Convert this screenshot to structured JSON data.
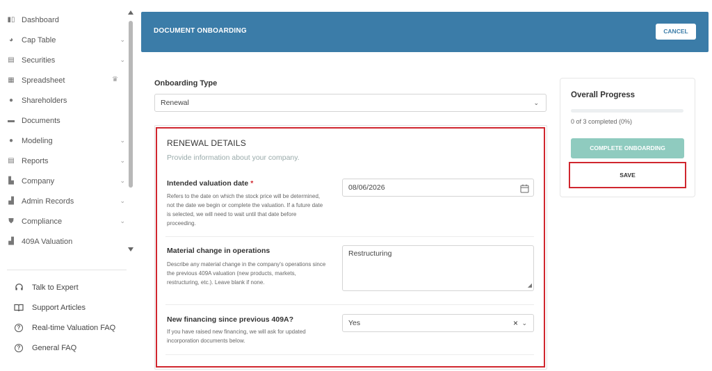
{
  "sidebar": {
    "items": [
      {
        "label": "Dashboard",
        "icon": "dashboard-icon",
        "chevron": false
      },
      {
        "label": "Cap Table",
        "icon": "pie-chart-icon",
        "chevron": true
      },
      {
        "label": "Securities",
        "icon": "clipboard-icon",
        "chevron": true
      },
      {
        "label": "Spreadsheet",
        "icon": "table-icon",
        "chevron": false,
        "crown": true
      },
      {
        "label": "Shareholders",
        "icon": "user-icon",
        "chevron": false
      },
      {
        "label": "Documents",
        "icon": "folder-icon",
        "chevron": false
      },
      {
        "label": "Modeling",
        "icon": "lightbulb-icon",
        "chevron": true
      },
      {
        "label": "Reports",
        "icon": "report-icon",
        "chevron": true
      },
      {
        "label": "Company",
        "icon": "building-icon",
        "chevron": true
      },
      {
        "label": "Admin Records",
        "icon": "records-icon",
        "chevron": true
      },
      {
        "label": "Compliance",
        "icon": "shield-icon",
        "chevron": true
      },
      {
        "label": "409A Valuation",
        "icon": "chart-icon",
        "chevron": false
      }
    ],
    "help": [
      {
        "label": "Talk to Expert",
        "icon": "headset-icon"
      },
      {
        "label": "Support Articles",
        "icon": "book-icon"
      },
      {
        "label": "Real-time Valuation FAQ",
        "icon": "question-circle-icon"
      },
      {
        "label": "General FAQ",
        "icon": "question-circle-icon"
      }
    ]
  },
  "header": {
    "title": "DOCUMENT ONBOARDING",
    "cancel_label": "CANCEL"
  },
  "form": {
    "onboarding_type_label": "Onboarding Type",
    "onboarding_type_value": "Renewal",
    "section_title": "RENEWAL DETAILS",
    "section_subtitle": "Provide information about your company.",
    "valuation_date": {
      "label": "Intended valuation date",
      "required_mark": "*",
      "help": "Refers to the date on which the stock price will be determined, not the date we begin or complete the valuation. If a future date is selected, we will need to wait until that date before proceeding.",
      "value": "08/06/2026"
    },
    "material_change": {
      "label": "Material change in operations",
      "help": "Describe any material change in the company's operations since the previous 409A valuation (new products, markets, restructuring, etc.). Leave blank if none.",
      "value": "Restructuring"
    },
    "new_financing": {
      "label": "New financing since previous 409A?",
      "help": "If you have raised new financing, we will ask for updated incorporation documents below.",
      "value": "Yes"
    }
  },
  "progress": {
    "title": "Overall Progress",
    "completed_text": "0 of 3 completed (0%)",
    "fraction": 0,
    "complete_label": "COMPLETE ONBOARDING",
    "save_label": "SAVE"
  },
  "colors": {
    "header_bg": "#3b7ca8",
    "highlight": "#d0262e",
    "complete_btn": "#8fcbbf"
  }
}
